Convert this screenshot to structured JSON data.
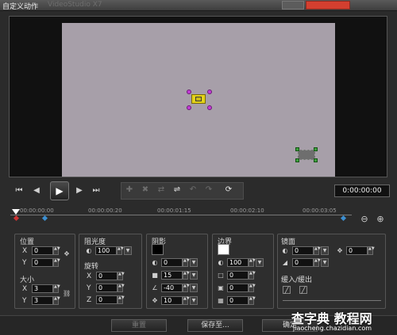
{
  "window": {
    "title": "自定义动作",
    "title_ghost": "VideoStudio X7"
  },
  "timecode": "0:00:00:00",
  "ruler": {
    "ticks": [
      "00:00:00:00",
      "00:00:00:20",
      "00:00:01:15",
      "00:00:02:10",
      "00:00:03:05"
    ]
  },
  "position": {
    "label": "位置",
    "x_label": "X",
    "y_label": "Y",
    "x": "0",
    "y": "0"
  },
  "size": {
    "label": "大小",
    "x_label": "X",
    "y_label": "Y",
    "x": "3",
    "y": "3"
  },
  "opacity": {
    "label": "阻光度",
    "value": "100"
  },
  "rotation": {
    "label": "旋转",
    "x_label": "X",
    "y_label": "Y",
    "z_label": "Z",
    "x": "0",
    "y": "0",
    "z": "0"
  },
  "shadow": {
    "label": "阴影",
    "v1": "0",
    "v2": "15",
    "v3": "-40",
    "v4": "10",
    "color": "#000000"
  },
  "border": {
    "label": "边界",
    "v1": "100",
    "v2": "0",
    "v3": "0",
    "v4": "0",
    "color": "#ffffff"
  },
  "mirror": {
    "label": "镜面",
    "v1": "0",
    "v2": "0",
    "v3": "0"
  },
  "fade": {
    "label": "缓入/缓出"
  },
  "buttons": {
    "reset": "重置",
    "save_as": "保存至...",
    "ok": "确定"
  },
  "watermark": {
    "brand": "查字典",
    "sub": "教程网",
    "url": "jiaocheng.chazidian.com"
  },
  "colors": {
    "accent_keyframe": "#3c8fd1",
    "handle": "#c23bd6",
    "close": "#d43f2f"
  }
}
